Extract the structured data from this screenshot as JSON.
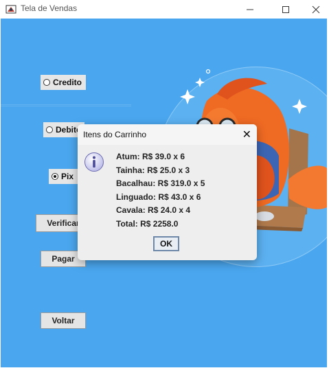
{
  "window": {
    "title": "Tela de Vendas",
    "controls": {
      "minimize": "—",
      "maximize": "☐",
      "close": "✕"
    }
  },
  "payment_options": [
    {
      "label": "Credito",
      "selected": false
    },
    {
      "label": "Debito",
      "selected": false
    },
    {
      "label": "Pix",
      "selected": true
    }
  ],
  "buttons": {
    "verify": "Verificar",
    "pay": "Pagar",
    "back": "Voltar"
  },
  "dialog": {
    "title": "Itens do Carrinho",
    "close": "✕",
    "icon": "info-icon",
    "lines": [
      "Atum: R$ 39.0 x 6",
      "Tainha: R$ 25.0 x 3",
      "Bacalhau: R$ 319.0 x 5",
      "Linguado: R$ 43.0 x 6",
      "Cavala: R$ 24.0 x 4",
      "Total: R$ 2258.0"
    ],
    "ok_label": "OK"
  },
  "colors": {
    "background": "#4aa7ef",
    "dialog_bg": "#eeeeee",
    "fish_body": "#ef6a23"
  }
}
